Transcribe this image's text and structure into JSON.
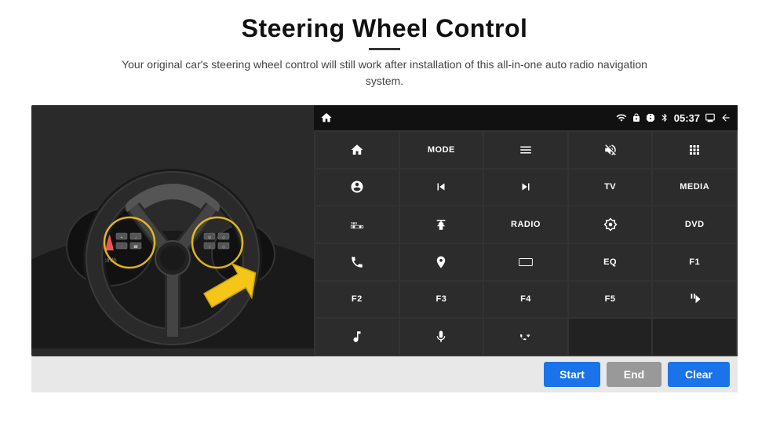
{
  "header": {
    "title": "Steering Wheel Control",
    "subtitle": "Your original car's steering wheel control will still work after installation of this all-in-one auto radio navigation system."
  },
  "status_bar": {
    "time": "05:37",
    "icons": [
      "wifi",
      "lock",
      "sim",
      "bluetooth",
      "display",
      "back"
    ]
  },
  "grid_buttons": [
    {
      "id": "r1c1",
      "type": "icon",
      "icon": "home",
      "label": ""
    },
    {
      "id": "r1c2",
      "type": "text",
      "label": "MODE"
    },
    {
      "id": "r1c3",
      "type": "icon",
      "icon": "list",
      "label": ""
    },
    {
      "id": "r1c4",
      "type": "icon",
      "icon": "mute",
      "label": ""
    },
    {
      "id": "r1c5",
      "type": "icon",
      "icon": "apps",
      "label": ""
    },
    {
      "id": "r2c1",
      "type": "icon",
      "icon": "settings-circle",
      "label": ""
    },
    {
      "id": "r2c2",
      "type": "icon",
      "icon": "prev",
      "label": ""
    },
    {
      "id": "r2c3",
      "type": "icon",
      "icon": "next",
      "label": ""
    },
    {
      "id": "r2c4",
      "type": "text",
      "label": "TV"
    },
    {
      "id": "r2c5",
      "type": "text",
      "label": "MEDIA"
    },
    {
      "id": "r3c1",
      "type": "icon",
      "icon": "360-car",
      "label": ""
    },
    {
      "id": "r3c2",
      "type": "icon",
      "icon": "eject",
      "label": ""
    },
    {
      "id": "r3c3",
      "type": "text",
      "label": "RADIO"
    },
    {
      "id": "r3c4",
      "type": "icon",
      "icon": "brightness",
      "label": ""
    },
    {
      "id": "r3c5",
      "type": "text",
      "label": "DVD"
    },
    {
      "id": "r4c1",
      "type": "icon",
      "icon": "phone",
      "label": ""
    },
    {
      "id": "r4c2",
      "type": "icon",
      "icon": "nav",
      "label": ""
    },
    {
      "id": "r4c3",
      "type": "icon",
      "icon": "screen",
      "label": ""
    },
    {
      "id": "r4c4",
      "type": "text",
      "label": "EQ"
    },
    {
      "id": "r4c5",
      "type": "text",
      "label": "F1"
    },
    {
      "id": "r5c1",
      "type": "text",
      "label": "F2"
    },
    {
      "id": "r5c2",
      "type": "text",
      "label": "F3"
    },
    {
      "id": "r5c3",
      "type": "text",
      "label": "F4"
    },
    {
      "id": "r5c4",
      "type": "text",
      "label": "F5"
    },
    {
      "id": "r5c5",
      "type": "icon",
      "icon": "play-pause",
      "label": ""
    },
    {
      "id": "r6c1",
      "type": "icon",
      "icon": "music",
      "label": ""
    },
    {
      "id": "r6c2",
      "type": "icon",
      "icon": "mic",
      "label": ""
    },
    {
      "id": "r6c3",
      "type": "icon",
      "icon": "phone-call",
      "label": ""
    },
    {
      "id": "r6c4",
      "type": "empty",
      "label": ""
    },
    {
      "id": "r6c5",
      "type": "empty",
      "label": ""
    }
  ],
  "bottom_bar": {
    "start_label": "Start",
    "end_label": "End",
    "clear_label": "Clear"
  }
}
